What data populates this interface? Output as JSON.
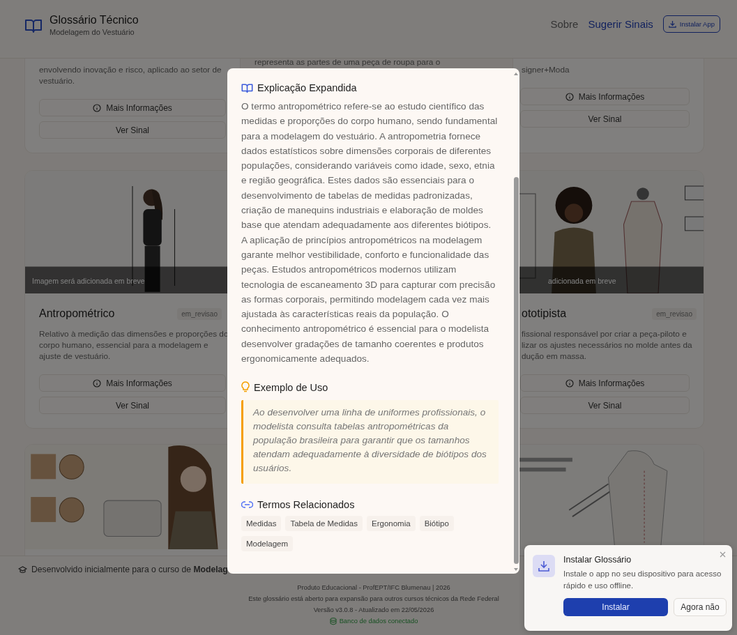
{
  "header": {
    "title": "Glossário Técnico",
    "subtitle": "Modelagem do Vestuário",
    "nav": [
      {
        "label": "Sobre",
        "kind": "plain"
      },
      {
        "label": "Sugerir Sinais",
        "kind": "accent"
      }
    ],
    "install_button": "Instalar App"
  },
  "card_rows": [
    [
      {
        "description": [
          "envolvendo inovação e risco, aplicado ao setor de",
          "vestuário."
        ],
        "buttons": [
          "Mais Informações",
          "Ver Sinal"
        ]
      },
      {
        "description": [
          "representa as partes de uma peça de roupa para o"
        ]
      },
      {
        "description": [
          "signer+Moda"
        ],
        "buttons": [
          "Mais Informações",
          "Ver Sinal"
        ]
      }
    ],
    [
      {
        "image": {
          "kind": "picture"
        },
        "caption": "Imagem será adicionada em breve",
        "title": "Antropométrico",
        "status": "em_revisao",
        "description": [
          "Relativo à medição das dimensões e proporções do",
          "corpo humano, essencial para a modelagem e",
          "ajuste de vestuário."
        ],
        "buttons": [
          "Mais Informações",
          "Ver Sinal"
        ]
      },
      {
        "image": {
          "kind": "picture"
        },
        "caption": "adicionada em breve",
        "title": "ototipista",
        "status": "em_revisao",
        "description": [
          "fissional responsável por criar a peça-piloto e",
          "lizar os ajustes necessários no molde antes da",
          "dução em massa."
        ],
        "buttons": [
          "Mais Informações",
          "Ver Sinal"
        ]
      }
    ],
    [
      {
        "image": {
          "kind": "picture"
        }
      },
      {
        "image": {
          "kind": "picture"
        }
      }
    ]
  ],
  "footer": {
    "credit": "Desenvolvido inicialmente para o curso de **Modelag**",
    "lines": [
      "Produto Educacional - ProfEPT/IFC Blumenau | 2026",
      "Este glossário está aberto para expansão para outros cursos técnicos da Rede Federal",
      "Versão v3.0.8 - Atualizado em 22/05/2026"
    ],
    "db_status": {
      "label": "Banco de dados conectado",
      "connected": true
    }
  },
  "modal": {
    "sections": [
      {
        "kind": "explanation",
        "title": "Explicação Expandida",
        "text": "O termo antropométrico refere-se ao estudo científico das medidas e proporções do corpo humano, sendo fundamental para a modelagem do vestuário. A antropometria fornece dados estatísticos sobre dimensões corporais de diferentes populações, considerando variáveis como idade, sexo, etnia e região geográfica. Estes dados são essenciais para o desenvolvimento de tabelas de medidas padronizadas, criação de manequins industriais e elaboração de moldes base que atendam adequadamente aos diferentes biótipos. A aplicação de princípios antropométricos na modelagem garante melhor vestibilidade, conforto e funcionalidade das peças. Estudos antropométricos modernos utilizam tecnologia de escaneamento 3D para capturar com precisão as formas corporais, permitindo modelagem cada vez mais ajustada às características reais da população. O conhecimento antropométrico é essencial para o modelista desenvolver gradações de tamanho coerentes e produtos ergonomicamente adequados."
      },
      {
        "kind": "example",
        "title": "Exemplo de Uso",
        "text": "Ao desenvolver uma linha de uniformes profissionais, o modelista consulta tabelas antropométricas da população brasileira para garantir que os tamanhos atendam adequadamente à diversidade de biótipos dos usuários."
      },
      {
        "kind": "related",
        "title": "Termos Relacionados",
        "terms": [
          "Medidas",
          "Tabela de Medidas",
          "Ergonomia",
          "Biótipo",
          "Modelagem"
        ]
      }
    ]
  },
  "toast": {
    "title": "Instalar Glossário",
    "text": "Instale o app no seu dispositivo para acesso rápido e uso offline.",
    "buttons": [
      {
        "label": "Instalar",
        "kind": "primary"
      },
      {
        "label": "Agora não",
        "kind": "secondary"
      }
    ]
  }
}
